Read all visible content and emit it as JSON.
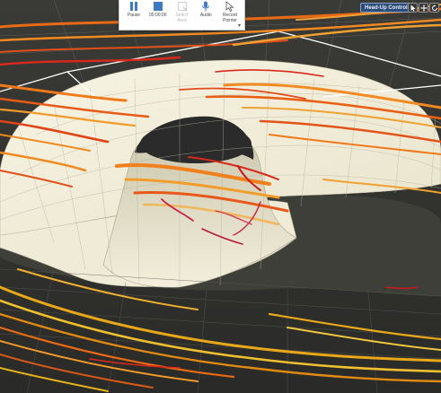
{
  "toolbar": {
    "pause_label": "Pause",
    "timer_label": "00:00:00",
    "select_area_label": "Select Area",
    "audio_label": "Audio",
    "record_pointer_label": "Record Pointer",
    "more_glyph": "▾"
  },
  "hud": {
    "controls_label": "Head-Up Controls"
  },
  "icons": {
    "pause": "pause-icon",
    "stop": "stop-icon",
    "select_area": "select-area-icon",
    "audio": "microphone-icon",
    "pointer": "pointer-icon",
    "cursor_mode": "cursor-icon",
    "pan": "pan-icon",
    "rotate": "rotate-icon"
  },
  "colors": {
    "background": "#2f2f2f",
    "surface": "#f2eedc",
    "streamline_orange": "#f07a1a",
    "streamline_red": "#d92a1e",
    "streamline_yellow": "#e8b31a",
    "hud_button": "#2c4c79"
  }
}
